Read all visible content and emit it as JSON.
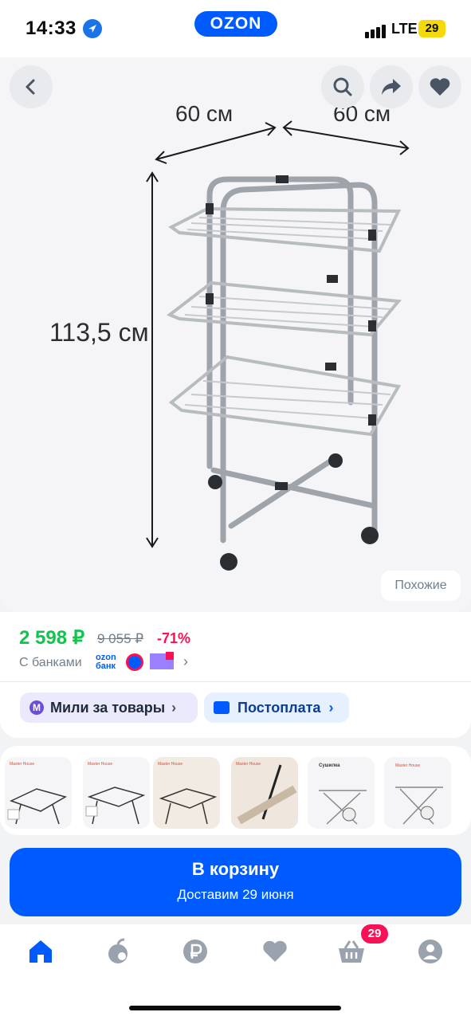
{
  "status_bar": {
    "time": "14:33",
    "network": "LTE",
    "battery": "29"
  },
  "header": {
    "brand": "OZON"
  },
  "product_image": {
    "width_label_left": "60 см",
    "width_label_right": "60 см",
    "height_label": "113,5 см",
    "similar_button": "Похожие"
  },
  "price": {
    "current": "2 598 ₽",
    "old": "9 055 ₽",
    "discount": "-71%",
    "banks_label": "С банками",
    "ozon_bank_line1": "ozon",
    "ozon_bank_line2": "банк"
  },
  "promos": {
    "miles": "Мили за товары",
    "postpay": "Постоплата"
  },
  "thumbnails": [
    {
      "caption": "Master House"
    },
    {
      "caption": "Master House"
    },
    {
      "caption": "Master House"
    },
    {
      "caption": "Master House"
    },
    {
      "caption": "Сушилка"
    },
    {
      "caption": "Master House"
    }
  ],
  "cart": {
    "label": "В корзину",
    "delivery": "Доставим 29 июня"
  },
  "bottom_nav": {
    "cart_badge": "29"
  },
  "colors": {
    "accent": "#005bff",
    "price": "#10c44c",
    "discount": "#f91155"
  },
  "icons": [
    "back-icon",
    "search-icon",
    "share-icon",
    "heart-icon",
    "home-icon",
    "fresh-icon",
    "ruble-icon",
    "favorites-icon",
    "cart-icon",
    "profile-icon"
  ]
}
